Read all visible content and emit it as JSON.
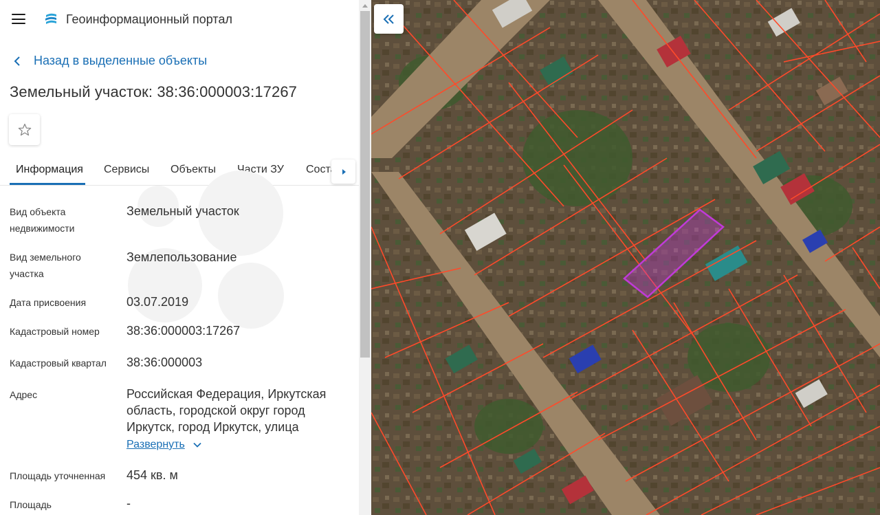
{
  "app": {
    "title": "Геоинформационный портал"
  },
  "back_link": {
    "label": "Назад в выделенные объекты"
  },
  "object": {
    "title": "Земельный участок: 38:36:000003:17267"
  },
  "tabs": [
    {
      "label": "Информация",
      "active": true
    },
    {
      "label": "Сервисы",
      "active": false
    },
    {
      "label": "Объекты",
      "active": false
    },
    {
      "label": "Части ЗУ",
      "active": false
    },
    {
      "label": "Соста",
      "active": false
    }
  ],
  "fields": [
    {
      "label_lines": [
        "Вид объекта",
        "недвижимости"
      ],
      "value_lines": [
        "Земельный участок"
      ]
    },
    {
      "label_lines": [
        "Вид земельного",
        "участка"
      ],
      "value_lines": [
        "Землепользование"
      ]
    },
    {
      "label_lines": [
        "Дата присвоения"
      ],
      "value_lines": [
        "03.07.2019"
      ]
    },
    {
      "label_lines": [
        "Кадастровый номер"
      ],
      "value_lines": [
        "38:36:000003:17267"
      ]
    },
    {
      "label_lines": [
        "Кадастровый квартал"
      ],
      "value_lines": [
        "38:36:000003"
      ]
    },
    {
      "label_lines": [
        "Адрес"
      ],
      "value_lines": [
        "Российская Федерация, Иркутская",
        "область, городской округ город",
        "Иркутск, город Иркутск, улица"
      ]
    },
    {
      "label_lines": [
        "Площадь уточненная"
      ],
      "value_lines": [
        "454 кв. м"
      ]
    },
    {
      "label_lines": [
        "Площадь"
      ],
      "value_lines": [
        "-"
      ]
    }
  ],
  "expand_link": {
    "label": "Развернуть"
  },
  "icons": {
    "menu": "hamburger-menu-icon",
    "logo": "portal-logo-icon",
    "back": "chevron-left-icon",
    "favorite": "star-outline-icon",
    "tabs_next": "caret-right-icon",
    "expand": "chevron-down-icon",
    "collapse_panel": "double-chevron-left-icon"
  },
  "colors": {
    "accent": "#1a6fb5",
    "parcel_border": "#ff4a2a",
    "selected_parcel": "#c03ad8"
  }
}
